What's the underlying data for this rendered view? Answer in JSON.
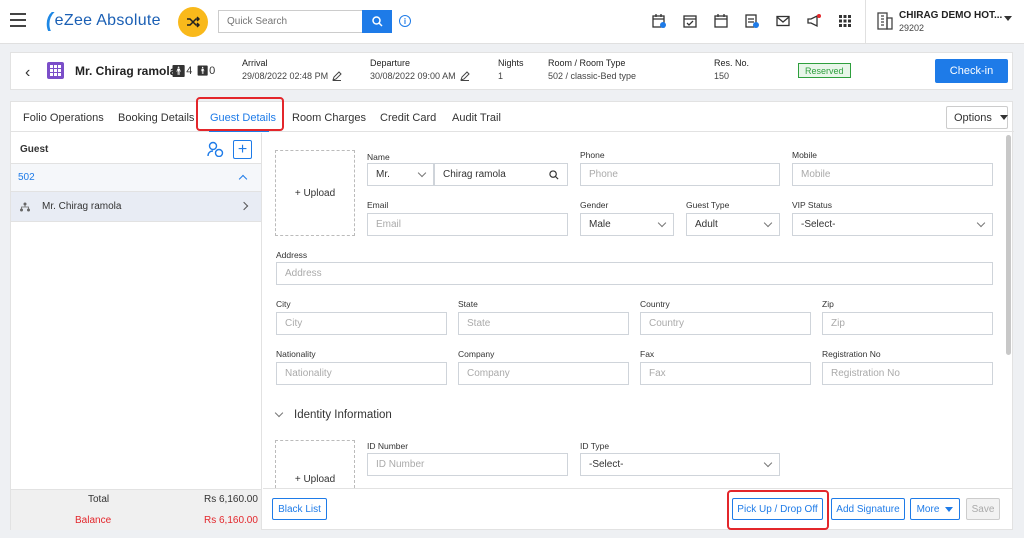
{
  "app": {
    "name": "eZee Absolute"
  },
  "search": {
    "placeholder": "Quick Search"
  },
  "hotel": {
    "name": "CHIRAG DEMO HOT...",
    "id": "29202"
  },
  "top_icons": [
    "calendar-check-icon",
    "ledger-icon",
    "calendar-icon",
    "invoice-icon",
    "mail-icon",
    "megaphone-icon",
    "apps-grid-icon"
  ],
  "reservation": {
    "guest_name": "Mr. Chirag ramola",
    "adults": "4",
    "children": "0",
    "arrival_label": "Arrival",
    "arrival_value": "29/08/2022 02:48 PM",
    "departure_label": "Departure",
    "departure_value": "30/08/2022 09:00 AM",
    "nights_label": "Nights",
    "nights_value": "1",
    "room_label": "Room / Room Type",
    "room_value": "502 / classic-Bed type",
    "resno_label": "Res. No.",
    "resno_value": "150",
    "status": "Reserved",
    "checkin_label": "Check-in"
  },
  "tabs": [
    {
      "label": "Folio Operations"
    },
    {
      "label": "Booking Details"
    },
    {
      "label": "Guest Details"
    },
    {
      "label": "Room Charges"
    },
    {
      "label": "Credit Card"
    },
    {
      "label": "Audit Trail"
    }
  ],
  "options_label": "Options",
  "guest_panel": {
    "title": "Guest",
    "room": "502",
    "guest": "Mr. Chirag ramola",
    "total_label": "Total",
    "total_value": "Rs 6,160.00",
    "balance_label": "Balance",
    "balance_value": "Rs 6,160.00"
  },
  "form": {
    "upload_label": "+ Upload",
    "name_label": "Name",
    "salutation": "Mr.",
    "name_value": "Chirag ramola",
    "phone_label": "Phone",
    "phone_placeholder": "Phone",
    "mobile_label": "Mobile",
    "mobile_placeholder": "Mobile",
    "email_label": "Email",
    "email_placeholder": "Email",
    "gender_label": "Gender",
    "gender_value": "Male",
    "guest_type_label": "Guest Type",
    "guest_type_value": "Adult",
    "vip_label": "VIP Status",
    "vip_value": "-Select-",
    "address_label": "Address",
    "address_placeholder": "Address",
    "city_label": "City",
    "city_placeholder": "City",
    "state_label": "State",
    "state_placeholder": "State",
    "country_label": "Country",
    "country_placeholder": "Country",
    "zip_label": "Zip",
    "zip_placeholder": "Zip",
    "nationality_label": "Nationality",
    "nationality_placeholder": "Nationality",
    "company_label": "Company",
    "company_placeholder": "Company",
    "fax_label": "Fax",
    "fax_placeholder": "Fax",
    "regno_label": "Registration No",
    "regno_placeholder": "Registration No",
    "identity_title": "Identity Information",
    "id_number_label": "ID Number",
    "id_number_placeholder": "ID Number",
    "id_type_label": "ID Type",
    "id_type_value": "-Select-"
  },
  "footer": {
    "blacklist": "Black List",
    "pickup": "Pick Up / Drop Off",
    "signature": "Add Signature",
    "more": "More",
    "save": "Save"
  },
  "colors": {
    "accent": "#1e7be8",
    "highlight": "#e3262b",
    "status_green": "#2e9f3d",
    "brand_yellow": "#f9b91b"
  }
}
